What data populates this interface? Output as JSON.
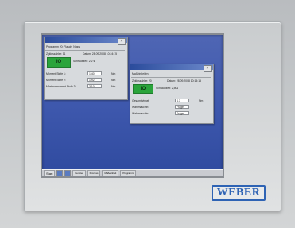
{
  "window1": {
    "title_bar": "",
    "heading": "Programm 20: Flasch_Nuss",
    "id_label": "Zykluszähler: 11",
    "date_label": "Datum: 28.09.2008 10:24:15",
    "io_label": "IO",
    "screw_time": "Schraubzeit: 2,2 s",
    "rows": [
      {
        "label": "Moment Stufe 1:",
        "value": "1,40",
        "unit": "Nm"
      },
      {
        "label": "Moment Stufe 2:",
        "value": "1,92",
        "unit": "Nm"
      },
      {
        "label": "Maximalmoment Stufe 3:",
        "value": "3,10",
        "unit": "Nm"
      }
    ]
  },
  "window2": {
    "title_bar": "",
    "heading": "Maßeinheiten",
    "id_label": "Zykluszähler: 20",
    "date_label": "Datum: 28.09.2008 10:15:15",
    "io_label": "IO",
    "screw_time": "Schraubzeit: 2,50s",
    "rows": [
      {
        "label": "Gesamtwinkel:",
        "value": "4,3",
        "unit": "Nm"
      },
      {
        "label": "Wahlmaschin:",
        "value": "Frage",
        "unit": ""
      },
      {
        "label": "Wahlmaschin:",
        "value": "Frage",
        "unit": ""
      }
    ]
  },
  "taskbar": {
    "start_label": "Start",
    "buttons": [
      "Fenster",
      "Prozess",
      "Maßeinheit",
      "Programm"
    ]
  },
  "brand": {
    "logo_text": "WEBER"
  },
  "colors": {
    "desktop": "#3e58ad",
    "io_green": "#2aa43b",
    "logo_blue": "#2e63b4"
  }
}
